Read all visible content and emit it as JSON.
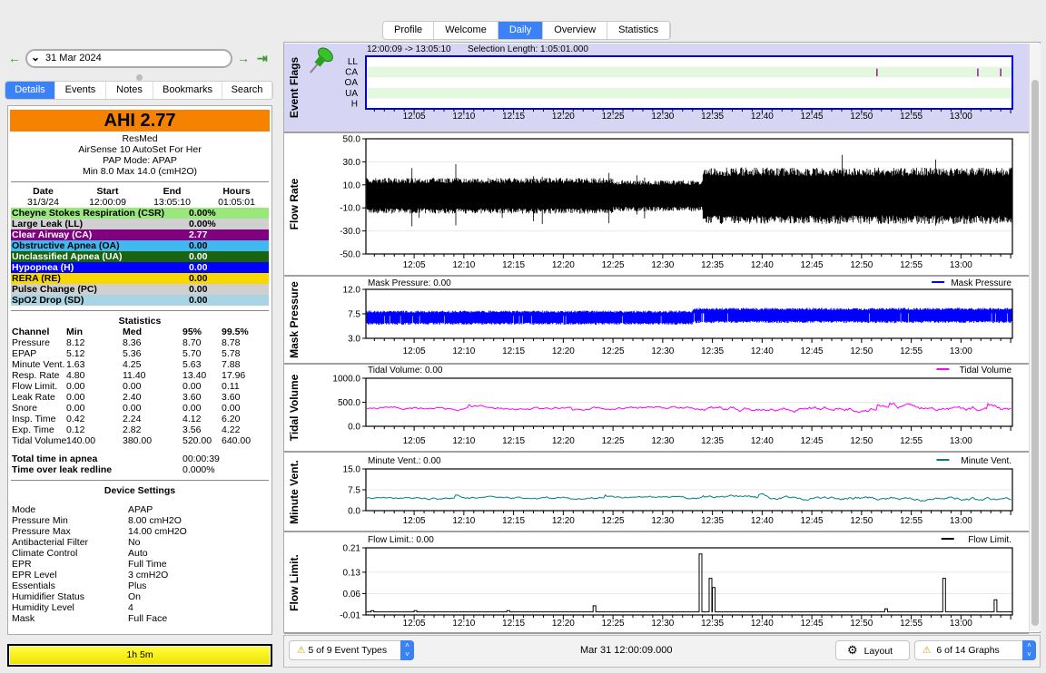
{
  "top_tabs": [
    {
      "label": "Profile"
    },
    {
      "label": "Welcome"
    },
    {
      "label": "Daily",
      "active": true
    },
    {
      "label": "Overview"
    },
    {
      "label": "Statistics"
    }
  ],
  "nav": {
    "date": "31 Mar 2024",
    "prev_icon": "arrow-left-icon",
    "next_icon": "arrow-right-icon",
    "last_icon": "arrow-end-icon"
  },
  "left_tabs": [
    {
      "label": "Details",
      "active": true
    },
    {
      "label": "Events"
    },
    {
      "label": "Notes"
    },
    {
      "label": "Bookmarks"
    },
    {
      "label": "Search"
    }
  ],
  "summary": {
    "ahi": "AHI  2.77",
    "ahi_color": "#f58200",
    "device_lines": [
      "ResMed",
      "AirSense 10 AutoSet For Her",
      "PAP Mode: APAP",
      "Min 8.0 Max 14.0 (cmH2O)"
    ],
    "session_headers": [
      "Date",
      "Start",
      "End",
      "Hours"
    ],
    "session_values": [
      "31/3/24",
      "12:00:09",
      "13:05:10",
      "01:05:01"
    ],
    "events": [
      {
        "name": "Cheyne Stokes Respiration (CSR)",
        "value": "0.00%",
        "bg": "#98e87c",
        "fg": "#000000"
      },
      {
        "name": "Large Leak (LL)",
        "value": "0.00%",
        "bg": "#d0d0d0",
        "fg": "#000000"
      },
      {
        "name": "Clear Airway (CA)",
        "value": "2.77",
        "bg": "#800080",
        "fg": "#ffffff"
      },
      {
        "name": "Obstructive Apnea (OA)",
        "value": "0.00",
        "bg": "#40b8f0",
        "fg": "#000000"
      },
      {
        "name": "Unclassified Apnea (UA)",
        "value": "0.00",
        "bg": "#1a6410",
        "fg": "#ffffff"
      },
      {
        "name": "Hypopnea (H)",
        "value": "0.00",
        "bg": "#0000ff",
        "fg": "#ffffff"
      },
      {
        "name": "RERA (RE)",
        "value": "0.00",
        "bg": "#f8d800",
        "fg": "#000000"
      },
      {
        "name": "Pulse Change (PC)",
        "value": "0.00",
        "bg": "#d0d0d0",
        "fg": "#000000"
      },
      {
        "name": "SpO2 Drop (SD)",
        "value": "0.00",
        "bg": "#a8d4e4",
        "fg": "#000000"
      }
    ]
  },
  "statistics": {
    "title": "Statistics",
    "headers": [
      "Channel",
      "Min",
      "Med",
      "95%",
      "99.5%"
    ],
    "rows": [
      [
        "Pressure",
        "8.12",
        "8.36",
        "8.70",
        "8.78"
      ],
      [
        "EPAP",
        "5.12",
        "5.36",
        "5.70",
        "5.78"
      ],
      [
        "Minute Vent.",
        "1.63",
        "4.25",
        "5.63",
        "7.88"
      ],
      [
        "Resp. Rate",
        "4.80",
        "11.40",
        "13.40",
        "17.96"
      ],
      [
        "Flow Limit.",
        "0.00",
        "0.00",
        "0.00",
        "0.11"
      ],
      [
        "Leak Rate",
        "0.00",
        "2.40",
        "3.60",
        "3.60"
      ],
      [
        "Snore",
        "0.00",
        "0.00",
        "0.00",
        "0.00"
      ],
      [
        "Insp. Time",
        "0.42",
        "2.24",
        "4.12",
        "6.20"
      ],
      [
        "Exp. Time",
        "0.12",
        "2.82",
        "3.56",
        "4.22"
      ],
      [
        "Tidal Volume",
        "140.00",
        "380.00",
        "520.00",
        "640.00"
      ]
    ],
    "totals": [
      {
        "label": "Total time in apnea",
        "value": "00:00:39"
      },
      {
        "label": "Time over leak redline",
        "value": "0.000%"
      }
    ]
  },
  "device_settings": {
    "title": "Device Settings",
    "items": [
      [
        "Mode",
        "APAP"
      ],
      [
        "Pressure Min",
        "8.00 cmH2O"
      ],
      [
        "Pressure Max",
        "14.00 cmH2O"
      ],
      [
        "Antibacterial Filter",
        "No"
      ],
      [
        "Climate Control",
        "Auto"
      ],
      [
        "EPR",
        "Full Time"
      ],
      [
        "EPR Level",
        "3 cmH2O"
      ],
      [
        "Essentials",
        "Plus"
      ],
      [
        "Humidifier Status",
        "On"
      ],
      [
        "Humidity Level",
        "4"
      ],
      [
        "Mask",
        "Full Face"
      ]
    ]
  },
  "time_bar": "1h 5m",
  "graph_header": {
    "range": "12:00:09 -> 13:05:10",
    "selection": "Selection Length: 1:05:01.000"
  },
  "chart_data": [
    {
      "name": "Event Flags",
      "type": "event-flags",
      "rows": [
        "LL",
        "CA",
        "OA",
        "UA",
        "H"
      ],
      "x_range": [
        "12:00:09",
        "13:05:10"
      ],
      "x_ticks": [
        "12:05",
        "12:10",
        "12:15",
        "12:20",
        "12:25",
        "12:30",
        "12:35",
        "12:40",
        "12:45",
        "12:50",
        "12:55",
        "13:00"
      ],
      "events": [
        {
          "row": "CA",
          "time": "12:51:33",
          "color": "#800080"
        },
        {
          "row": "CA",
          "time": "13:01:42",
          "color": "#800080"
        },
        {
          "row": "CA",
          "time": "13:04:00",
          "color": "#800080"
        }
      ]
    },
    {
      "name": "Flow Rate",
      "type": "line",
      "ylabel": "Flow Rate",
      "ylim": [
        -50,
        50
      ],
      "y_ticks": [
        "50.0",
        "30.0",
        "10.0",
        "-10.0",
        "-30.0",
        "-50.0"
      ],
      "color": "#000000",
      "envelope": [
        {
          "from": "12:00",
          "to": "12:25",
          "range": [
            -15,
            16
          ]
        },
        {
          "from": "12:25",
          "to": "12:34",
          "range": [
            -13,
            14
          ]
        },
        {
          "from": "12:34",
          "to": "13:05",
          "range": [
            -24,
            25
          ]
        }
      ]
    },
    {
      "name": "Mask Pressure",
      "type": "line",
      "ylabel": "Mask Pressure",
      "header": "Mask Pressure: 0.00",
      "legend": "Mask Pressure",
      "ylim": [
        3,
        12
      ],
      "y_ticks": [
        "12.0",
        "7.5",
        "3.0"
      ],
      "color": "#0000ff",
      "envelope": [
        {
          "from": "12:00",
          "to": "12:33",
          "range": [
            5.5,
            8.1
          ]
        },
        {
          "from": "12:33",
          "to": "13:05",
          "range": [
            5.8,
            8.6
          ]
        }
      ]
    },
    {
      "name": "Tidal Volume",
      "type": "line",
      "ylabel": "Tidal Volume",
      "header": "Tidal Volume: 0.00",
      "legend": "Tidal Volume",
      "ylim": [
        0,
        1000
      ],
      "y_ticks": [
        "1000.0",
        "500.0",
        "0.0"
      ],
      "color": "#ff00ff",
      "typical": [
        300,
        450
      ]
    },
    {
      "name": "Minute Vent.",
      "type": "line",
      "ylabel": "Minute Vent.",
      "header": "Minute Vent.: 0.00",
      "legend": "Minute Vent.",
      "ylim": [
        0,
        15
      ],
      "y_ticks": [
        "15.0",
        "7.5",
        "0.0"
      ],
      "color": "#008080",
      "typical": [
        3.5,
        5.5
      ]
    },
    {
      "name": "Flow Limit.",
      "type": "line",
      "ylabel": "Flow Limit.",
      "header": "Flow Limit.: 0.00",
      "legend": "Flow Limit.",
      "ylim": [
        -0.01,
        0.21
      ],
      "y_ticks": [
        "0.21",
        "0.13",
        "0.06",
        "-0.01"
      ],
      "color": "#000000",
      "spikes": [
        {
          "time": "12:00:40",
          "value": 0.0
        },
        {
          "time": "12:05:00",
          "value": 0.0
        },
        {
          "time": "12:14:20",
          "value": 0.0
        },
        {
          "time": "12:23:00",
          "value": 0.02
        },
        {
          "time": "12:33:40",
          "value": 0.19
        },
        {
          "time": "12:34:40",
          "value": 0.11
        },
        {
          "time": "12:35:00",
          "value": 0.08
        },
        {
          "time": "12:52:20",
          "value": 0.01
        },
        {
          "time": "12:58:10",
          "value": 0.11
        },
        {
          "time": "13:03:20",
          "value": 0.04
        }
      ]
    }
  ],
  "bottom_bar": {
    "event_types": "5 of 9 Event Types",
    "timestamp": "Mar 31 12:00:09.000",
    "layout": "Layout",
    "graphs": "6 of 14 Graphs",
    "warning_icon": "warning-icon",
    "gear_icon": "gear-icon"
  }
}
